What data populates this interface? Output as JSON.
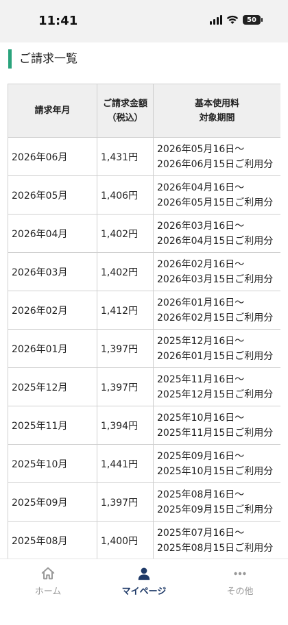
{
  "status": {
    "time": "11:41",
    "battery": "50"
  },
  "page": {
    "title": "ご請求一覧"
  },
  "table": {
    "headers": {
      "month": "請求年月",
      "amount_line1": "ご請求金額",
      "amount_line2": "（税込）",
      "period_line1": "基本使用料",
      "period_line2": "対象期間"
    },
    "rows": [
      {
        "month": "2026年06月",
        "amount": "1,431円",
        "from": "2026年05月16日〜",
        "to": "2026年06月15日ご利用分"
      },
      {
        "month": "2026年05月",
        "amount": "1,406円",
        "from": "2026年04月16日〜",
        "to": "2026年05月15日ご利用分"
      },
      {
        "month": "2026年04月",
        "amount": "1,402円",
        "from": "2026年03月16日〜",
        "to": "2026年04月15日ご利用分"
      },
      {
        "month": "2026年03月",
        "amount": "1,402円",
        "from": "2026年02月16日〜",
        "to": "2026年03月15日ご利用分"
      },
      {
        "month": "2026年02月",
        "amount": "1,412円",
        "from": "2026年01月16日〜",
        "to": "2026年02月15日ご利用分"
      },
      {
        "month": "2026年01月",
        "amount": "1,397円",
        "from": "2025年12月16日〜",
        "to": "2026年01月15日ご利用分"
      },
      {
        "month": "2025年12月",
        "amount": "1,397円",
        "from": "2025年11月16日〜",
        "to": "2025年12月15日ご利用分"
      },
      {
        "month": "2025年11月",
        "amount": "1,394円",
        "from": "2025年10月16日〜",
        "to": "2025年11月15日ご利用分"
      },
      {
        "month": "2025年10月",
        "amount": "1,441円",
        "from": "2025年09月16日〜",
        "to": "2025年10月15日ご利用分"
      },
      {
        "month": "2025年09月",
        "amount": "1,397円",
        "from": "2025年08月16日〜",
        "to": "2025年09月15日ご利用分"
      },
      {
        "month": "2025年08月",
        "amount": "1,400円",
        "from": "2025年07月16日〜",
        "to": "2025年08月15日ご利用分"
      }
    ]
  },
  "tabbar": {
    "items": [
      {
        "label": "ホーム",
        "icon": "home-icon",
        "active": false
      },
      {
        "label": "マイページ",
        "icon": "person-icon",
        "active": true
      },
      {
        "label": "その他",
        "icon": "more-icon",
        "active": false
      }
    ]
  },
  "colors": {
    "accent": "#2aa37c",
    "active_tab": "#1f3a68",
    "inactive_tab": "#999999"
  }
}
